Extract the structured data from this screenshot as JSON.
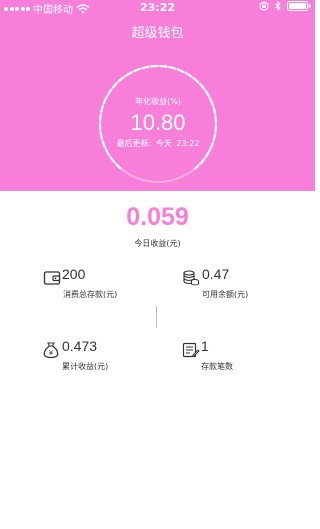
{
  "status_bar": {
    "carrier": "中国移动",
    "time": "23:22"
  },
  "header": {
    "title": "超级钱包",
    "rate_label": "年化收益(%)",
    "rate_value": "10.80",
    "updated_label": "最后更新:",
    "updated_day": "今天",
    "updated_time": "23:22",
    "background_color": "#f77fd9"
  },
  "today": {
    "value": "0.059",
    "label": "今日收益(元)"
  },
  "stats": [
    {
      "icon": "wallet-icon",
      "value": "200",
      "label": "消费总存款(元)"
    },
    {
      "icon": "coins-stack-icon",
      "value": "0.47",
      "label": "可用余额(元)"
    },
    {
      "icon": "money-bag-icon",
      "value": "0.473",
      "label": "累计收益(元)"
    },
    {
      "icon": "ledger-icon",
      "value": "1",
      "label": "存款笔数"
    }
  ],
  "colors": {
    "accent": "#f77fd9",
    "text": "#333333"
  }
}
